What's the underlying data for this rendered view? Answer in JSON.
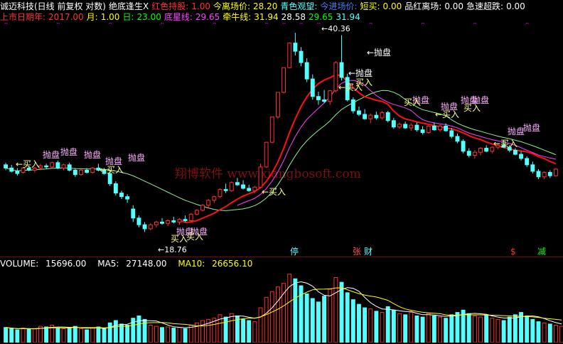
{
  "header": {
    "stock": "诚迈科技(日线 前复权 对数)",
    "indicator_name": "绝底逢生X",
    "hold_label": "红色持股:",
    "hold_value": "1.00",
    "exit_label": "今离场价:",
    "exit_value": "28.20",
    "watch_label": "青色观望:",
    "entry_label": "今进场价:",
    "short_buy_label": "短买:",
    "short_buy_value": "0.00",
    "pin_label": "品红离场:",
    "pin_value": "0.00",
    "surge_label": "急速超跌:",
    "surge_value": "0.00",
    "year_label": "上市日期年:",
    "year_value": "2017.00",
    "month_label": "月:",
    "month_value": "1.00",
    "day_label": "日:",
    "day_value": "23.00",
    "bottom_star_label": "底星线:",
    "bottom_star_value": "29.65",
    "bull_label": "牵牛线:",
    "bull_value": "31.94",
    "l2_v1": "28.58",
    "l2_v2": "29.65",
    "l2_v3": "31.94"
  },
  "colors": {
    "up": "#ff3030",
    "down": "#54ffff",
    "yellow": "#ffff00",
    "magenta": "#ff00ff",
    "green": "#00ff00",
    "white": "#ffffff",
    "ma_white": "#e8e8e8",
    "ma_green": "#90ee90",
    "ma_magenta": "#ff40ff",
    "red_line": "#ff1010",
    "label": "#ffb0ff",
    "watermark": "#7a1010",
    "blue_label": "#4080ff"
  },
  "watermark": "翔博软件 www.xiangbosoft.com",
  "annotations": {
    "low_price": "←18.76",
    "high_price": "←40.36",
    "sell": "抛盘",
    "buy": "买入",
    "sell_arrow": "←抛盘",
    "buy_arrow": "←买入",
    "ting": "停",
    "zhang": "张",
    "cai": "财",
    "dollar": "$",
    "jian": "减"
  },
  "volume": {
    "label": "VOLUME:",
    "value": "15696.00",
    "ma5_label": "MA5:",
    "ma5_value": "27148.00",
    "ma10_label": "MA10:",
    "ma10_value": "26656.10"
  },
  "chart_data": {
    "type": "candlestick",
    "candles": [
      {
        "o": 24.3,
        "h": 24.5,
        "l": 23.8,
        "c": 24.0
      },
      {
        "o": 24.0,
        "h": 24.3,
        "l": 23.6,
        "c": 23.7
      },
      {
        "o": 23.7,
        "h": 24.0,
        "l": 23.3,
        "c": 23.5
      },
      {
        "o": 23.6,
        "h": 24.1,
        "l": 23.5,
        "c": 24.0
      },
      {
        "o": 24.0,
        "h": 24.2,
        "l": 23.7,
        "c": 23.8
      },
      {
        "o": 23.8,
        "h": 24.1,
        "l": 23.6,
        "c": 24.0
      },
      {
        "o": 24.0,
        "h": 24.4,
        "l": 23.8,
        "c": 24.2
      },
      {
        "o": 24.2,
        "h": 24.4,
        "l": 23.9,
        "c": 24.1
      },
      {
        "o": 24.1,
        "h": 24.6,
        "l": 24.0,
        "c": 24.5
      },
      {
        "o": 24.5,
        "h": 24.7,
        "l": 23.9,
        "c": 24.0
      },
      {
        "o": 24.0,
        "h": 24.4,
        "l": 23.8,
        "c": 24.3
      },
      {
        "o": 24.3,
        "h": 24.5,
        "l": 23.7,
        "c": 23.8
      },
      {
        "o": 23.8,
        "h": 24.0,
        "l": 23.2,
        "c": 23.4
      },
      {
        "o": 23.4,
        "h": 23.9,
        "l": 23.3,
        "c": 23.8
      },
      {
        "o": 23.8,
        "h": 24.0,
        "l": 23.5,
        "c": 23.6
      },
      {
        "o": 23.6,
        "h": 24.1,
        "l": 23.5,
        "c": 24.0
      },
      {
        "o": 24.0,
        "h": 24.4,
        "l": 23.7,
        "c": 23.8
      },
      {
        "o": 23.8,
        "h": 24.0,
        "l": 23.4,
        "c": 23.5
      },
      {
        "o": 23.5,
        "h": 23.8,
        "l": 22.4,
        "c": 22.6
      },
      {
        "o": 22.6,
        "h": 22.8,
        "l": 21.6,
        "c": 21.8
      },
      {
        "o": 21.8,
        "h": 22.0,
        "l": 21.3,
        "c": 21.5
      },
      {
        "o": 21.5,
        "h": 21.7,
        "l": 21.0,
        "c": 21.3
      },
      {
        "o": 20.5,
        "h": 20.8,
        "l": 19.5,
        "c": 19.8
      },
      {
        "o": 19.8,
        "h": 20.0,
        "l": 19.1,
        "c": 19.3
      },
      {
        "o": 19.3,
        "h": 19.5,
        "l": 18.76,
        "c": 19.0
      },
      {
        "o": 19.0,
        "h": 19.4,
        "l": 18.9,
        "c": 19.3
      },
      {
        "o": 19.3,
        "h": 19.6,
        "l": 19.1,
        "c": 19.5
      },
      {
        "o": 19.5,
        "h": 19.8,
        "l": 19.3,
        "c": 19.4
      },
      {
        "o": 19.4,
        "h": 19.7,
        "l": 19.2,
        "c": 19.6
      },
      {
        "o": 19.6,
        "h": 19.9,
        "l": 19.4,
        "c": 19.5
      },
      {
        "o": 19.5,
        "h": 19.8,
        "l": 19.3,
        "c": 19.7
      },
      {
        "o": 19.7,
        "h": 20.0,
        "l": 19.5,
        "c": 19.6
      },
      {
        "o": 19.6,
        "h": 20.2,
        "l": 19.5,
        "c": 20.1
      },
      {
        "o": 20.1,
        "h": 20.5,
        "l": 20.0,
        "c": 20.4
      },
      {
        "o": 20.4,
        "h": 20.9,
        "l": 20.3,
        "c": 20.8
      },
      {
        "o": 20.8,
        "h": 21.3,
        "l": 20.6,
        "c": 21.2
      },
      {
        "o": 21.2,
        "h": 21.6,
        "l": 21.0,
        "c": 21.5
      },
      {
        "o": 21.5,
        "h": 22.2,
        "l": 21.4,
        "c": 22.1
      },
      {
        "o": 22.1,
        "h": 22.6,
        "l": 21.8,
        "c": 22.0
      },
      {
        "o": 22.0,
        "h": 22.8,
        "l": 21.9,
        "c": 22.7
      },
      {
        "o": 22.7,
        "h": 23.1,
        "l": 22.4,
        "c": 22.5
      },
      {
        "o": 22.5,
        "h": 22.9,
        "l": 22.1,
        "c": 22.2
      },
      {
        "o": 22.2,
        "h": 22.5,
        "l": 21.9,
        "c": 22.0
      },
      {
        "o": 22.0,
        "h": 22.4,
        "l": 21.8,
        "c": 22.3
      },
      {
        "o": 22.3,
        "h": 24.4,
        "l": 22.2,
        "c": 24.1
      },
      {
        "o": 24.1,
        "h": 26.5,
        "l": 24.0,
        "c": 26.5
      },
      {
        "o": 26.5,
        "h": 29.2,
        "l": 26.4,
        "c": 29.2
      },
      {
        "o": 29.2,
        "h": 32.1,
        "l": 29.0,
        "c": 32.1
      },
      {
        "o": 32.1,
        "h": 35.3,
        "l": 32.0,
        "c": 35.3
      },
      {
        "o": 35.3,
        "h": 38.9,
        "l": 35.2,
        "c": 38.8
      },
      {
        "o": 38.8,
        "h": 40.36,
        "l": 37.0,
        "c": 37.6
      },
      {
        "o": 37.6,
        "h": 38.2,
        "l": 35.5,
        "c": 36.0
      },
      {
        "o": 36.0,
        "h": 36.6,
        "l": 33.4,
        "c": 33.8
      },
      {
        "o": 33.8,
        "h": 34.4,
        "l": 31.2,
        "c": 31.6
      },
      {
        "o": 31.6,
        "h": 32.2,
        "l": 30.6,
        "c": 31.2
      },
      {
        "o": 31.2,
        "h": 32.4,
        "l": 30.8,
        "c": 31.0
      },
      {
        "o": 31.0,
        "h": 32.4,
        "l": 30.6,
        "c": 32.3
      },
      {
        "o": 32.3,
        "h": 36.2,
        "l": 32.1,
        "c": 36.0
      },
      {
        "o": 36.0,
        "h": 40.0,
        "l": 33.6,
        "c": 34.0
      },
      {
        "o": 34.0,
        "h": 34.5,
        "l": 31.0,
        "c": 31.2
      },
      {
        "o": 31.2,
        "h": 31.5,
        "l": 29.6,
        "c": 29.9
      },
      {
        "o": 29.9,
        "h": 30.4,
        "l": 29.3,
        "c": 29.5
      },
      {
        "o": 29.5,
        "h": 30.1,
        "l": 28.9,
        "c": 29.0
      },
      {
        "o": 29.0,
        "h": 29.6,
        "l": 28.5,
        "c": 29.4
      },
      {
        "o": 29.4,
        "h": 29.8,
        "l": 28.9,
        "c": 29.1
      },
      {
        "o": 29.1,
        "h": 29.9,
        "l": 28.9,
        "c": 29.7
      },
      {
        "o": 29.7,
        "h": 29.9,
        "l": 28.6,
        "c": 28.8
      },
      {
        "o": 28.8,
        "h": 29.1,
        "l": 27.9,
        "c": 28.1
      },
      {
        "o": 28.1,
        "h": 28.6,
        "l": 27.9,
        "c": 28.4
      },
      {
        "o": 28.4,
        "h": 28.7,
        "l": 27.9,
        "c": 28.0
      },
      {
        "o": 28.0,
        "h": 28.5,
        "l": 27.7,
        "c": 28.3
      },
      {
        "o": 28.3,
        "h": 28.6,
        "l": 27.6,
        "c": 27.8
      },
      {
        "o": 27.8,
        "h": 28.2,
        "l": 27.3,
        "c": 27.5
      },
      {
        "o": 27.5,
        "h": 28.3,
        "l": 27.4,
        "c": 28.2
      },
      {
        "o": 28.2,
        "h": 28.6,
        "l": 27.7,
        "c": 27.8
      },
      {
        "o": 27.8,
        "h": 28.4,
        "l": 27.6,
        "c": 28.2
      },
      {
        "o": 28.2,
        "h": 28.5,
        "l": 27.6,
        "c": 27.7
      },
      {
        "o": 27.7,
        "h": 28.0,
        "l": 26.9,
        "c": 27.1
      },
      {
        "o": 27.1,
        "h": 27.4,
        "l": 26.4,
        "c": 26.6
      },
      {
        "o": 26.6,
        "h": 26.8,
        "l": 25.4,
        "c": 25.6
      },
      {
        "o": 25.6,
        "h": 25.9,
        "l": 25.0,
        "c": 25.2
      },
      {
        "o": 25.2,
        "h": 25.7,
        "l": 24.9,
        "c": 25.5
      },
      {
        "o": 25.5,
        "h": 26.0,
        "l": 25.2,
        "c": 25.9
      },
      {
        "o": 25.9,
        "h": 26.2,
        "l": 25.5,
        "c": 25.6
      },
      {
        "o": 25.6,
        "h": 26.1,
        "l": 25.4,
        "c": 26.0
      },
      {
        "o": 26.0,
        "h": 26.4,
        "l": 25.8,
        "c": 26.2
      },
      {
        "o": 26.2,
        "h": 26.7,
        "l": 25.9,
        "c": 26.0
      },
      {
        "o": 26.0,
        "h": 26.2,
        "l": 25.5,
        "c": 25.7
      },
      {
        "o": 25.7,
        "h": 25.9,
        "l": 25.2,
        "c": 25.3
      },
      {
        "o": 25.3,
        "h": 25.6,
        "l": 24.7,
        "c": 24.9
      },
      {
        "o": 24.9,
        "h": 25.1,
        "l": 24.1,
        "c": 24.3
      },
      {
        "o": 24.3,
        "h": 24.6,
        "l": 23.5,
        "c": 23.7
      },
      {
        "o": 23.7,
        "h": 23.9,
        "l": 23.0,
        "c": 23.2
      },
      {
        "o": 23.2,
        "h": 23.7,
        "l": 23.0,
        "c": 23.6
      },
      {
        "o": 23.6,
        "h": 23.8,
        "l": 23.1,
        "c": 23.3
      },
      {
        "o": 23.3,
        "h": 24.0,
        "l": 23.2,
        "c": 23.9
      }
    ],
    "volume": [
      26,
      24,
      22,
      25,
      23,
      24,
      28,
      27,
      30,
      25,
      24,
      26,
      28,
      24,
      22,
      25,
      27,
      24,
      34,
      38,
      32,
      30,
      42,
      46,
      40,
      30,
      28,
      26,
      27,
      25,
      26,
      24,
      30,
      34,
      38,
      40,
      42,
      48,
      44,
      50,
      46,
      40,
      38,
      36,
      60,
      78,
      88,
      96,
      102,
      118,
      110,
      98,
      84,
      76,
      70,
      80,
      92,
      112,
      104,
      86,
      74,
      66,
      60,
      58,
      54,
      52,
      62,
      56,
      50,
      48,
      52,
      46,
      44,
      50,
      46,
      44,
      42,
      48,
      52,
      56,
      50,
      46,
      44,
      48,
      42,
      40,
      38,
      44,
      48,
      52,
      46,
      40,
      36,
      34,
      32,
      30,
      28
    ],
    "ma5": [
      27.1,
      27.6
    ],
    "ma10": [
      26.6,
      26.7
    ]
  }
}
